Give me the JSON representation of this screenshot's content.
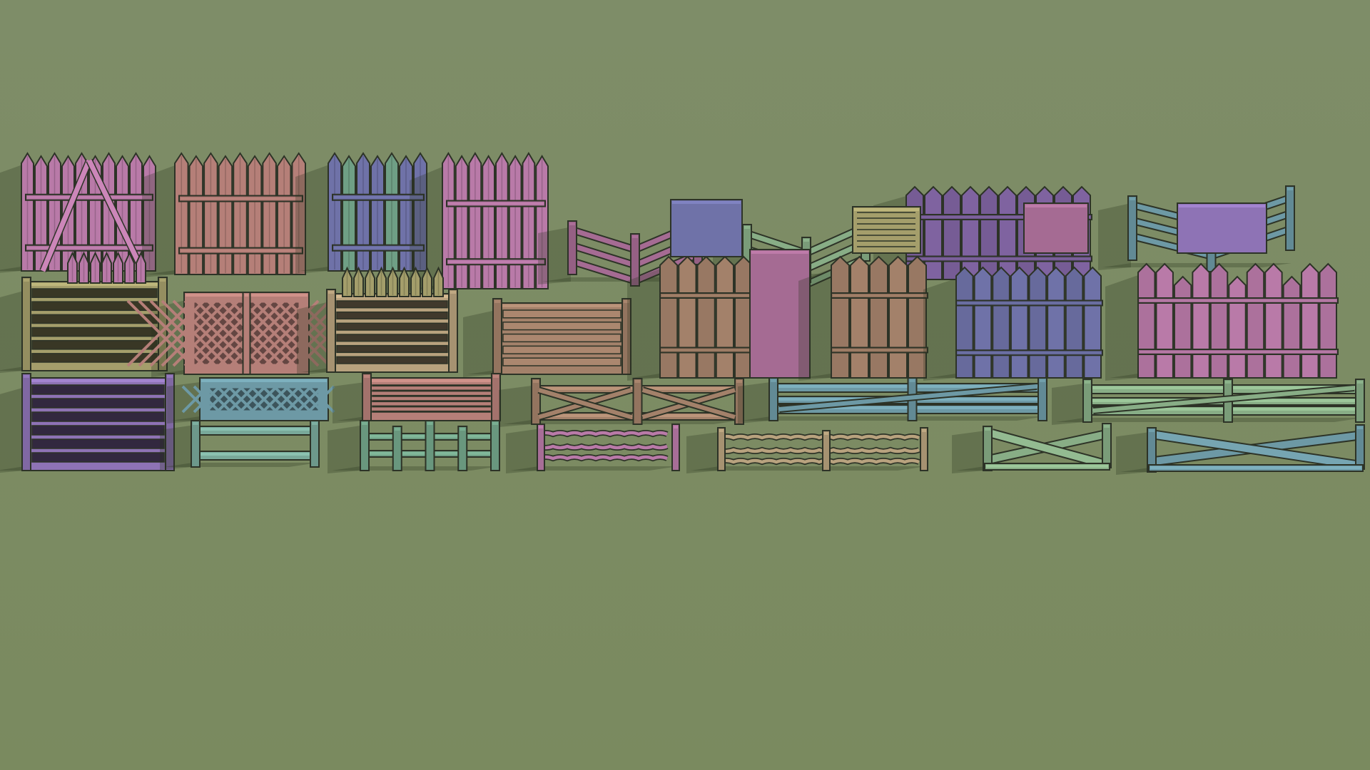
{
  "scene": {
    "background": {
      "top": "#7e8d68",
      "bottom": "#7a8a5f"
    },
    "outline": "#2d3327",
    "shadow": "rgba(40,50,30,0.28)",
    "palette": {
      "pink": "#b97aa8",
      "rose": "#b57f78",
      "purple": "#7f63a0",
      "violet": "#8e73b5",
      "indigo": "#6f72a8",
      "green": "#6f9f85",
      "mint": "#79a99a",
      "teal": "#6d99a5",
      "olive": "#a49e6b",
      "tan": "#b8a27e",
      "brown": "#a3816a",
      "magenta": "#a56b93",
      "sage": "#88ad86"
    },
    "fence_assets": [
      {
        "name": "tall-stakes-crossed",
        "style": "stakes",
        "color": "pink"
      },
      {
        "name": "tall-stakes-wall",
        "style": "stakes",
        "color": "rose"
      },
      {
        "name": "stakes-group-blue-green",
        "style": "stakes",
        "color": "indigo"
      },
      {
        "name": "stakes-group-pink",
        "style": "stakes",
        "color": "pink"
      },
      {
        "name": "corner-rail-red",
        "style": "corner-rail",
        "color": "magenta"
      },
      {
        "name": "corner-rail-green",
        "style": "corner-rail",
        "color": "sage"
      },
      {
        "name": "picket-corner-purple",
        "style": "picket",
        "color": "purple"
      },
      {
        "name": "corner-rail-teal",
        "style": "corner-rail",
        "color": "teal"
      },
      {
        "name": "slat-panel-olive",
        "style": "slats",
        "color": "olive"
      },
      {
        "name": "lattice-panel-rose",
        "style": "lattice",
        "color": "rose"
      },
      {
        "name": "slat-panel-tan",
        "style": "slats",
        "color": "tan"
      },
      {
        "name": "plank-fence-brown",
        "style": "planks",
        "color": "brown"
      },
      {
        "name": "picket-gate-brown",
        "style": "picket",
        "color": "brown"
      },
      {
        "name": "picket-vent-brown",
        "style": "picket",
        "color": "brown"
      },
      {
        "name": "picket-fence-indigo",
        "style": "picket",
        "color": "indigo"
      },
      {
        "name": "picket-broken-pink",
        "style": "picket",
        "color": "pink"
      },
      {
        "name": "low-slat-violet",
        "style": "slats",
        "color": "violet"
      },
      {
        "name": "lattice-low-teal",
        "style": "lattice",
        "color": "teal"
      },
      {
        "name": "rail-low-mint",
        "style": "rail",
        "color": "mint"
      },
      {
        "name": "slat-low-rose",
        "style": "slats",
        "color": "rose"
      },
      {
        "name": "cross-rail-brown",
        "style": "cross",
        "color": "brown"
      },
      {
        "name": "long-rail-teal",
        "style": "rail",
        "color": "teal"
      },
      {
        "name": "long-rail-green",
        "style": "rail",
        "color": "sage"
      },
      {
        "name": "post-rail-green",
        "style": "post-rail",
        "color": "green"
      },
      {
        "name": "twig-rail-pink",
        "style": "twig",
        "color": "pink"
      },
      {
        "name": "twig-rail-tan",
        "style": "twig",
        "color": "tan"
      },
      {
        "name": "x-rail-green",
        "style": "x-rail",
        "color": "sage"
      },
      {
        "name": "x-rail-teal",
        "style": "x-rail",
        "color": "teal"
      }
    ]
  }
}
